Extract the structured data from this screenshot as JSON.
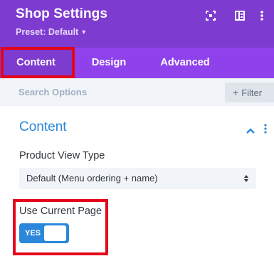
{
  "header": {
    "title": "Shop Settings",
    "preset_label": "Preset: Default",
    "icons": [
      "expand-icon",
      "sidebar-toggle-icon",
      "more-vertical-icon"
    ]
  },
  "tabs": [
    {
      "label": "Content",
      "active": true
    },
    {
      "label": "Design",
      "active": false
    },
    {
      "label": "Advanced",
      "active": false
    }
  ],
  "search": {
    "placeholder": "Search Options",
    "filter_label": "Filter"
  },
  "section": {
    "title": "Content",
    "expanded": true
  },
  "fields": {
    "product_view_type": {
      "label": "Product View Type",
      "value": "Default (Menu ordering + name)"
    },
    "use_current_page": {
      "label": "Use Current Page",
      "toggle_text": "YES",
      "enabled": true
    }
  },
  "colors": {
    "header_bg": "#7e3bd0",
    "tabs_bg": "#8f42ec",
    "accent_blue": "#2b87da",
    "highlight_red": "#e3061a"
  }
}
